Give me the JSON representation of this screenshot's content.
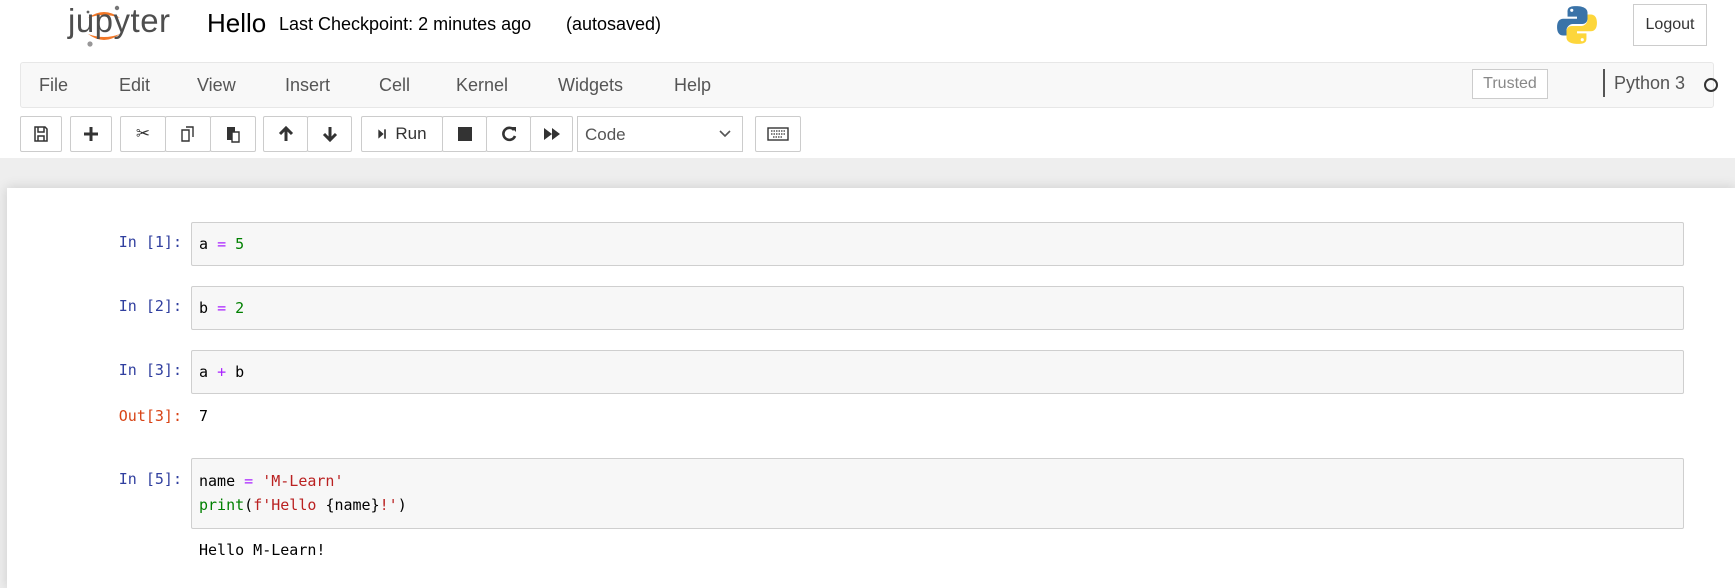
{
  "header": {
    "logo_text": "jupyter",
    "notebook_name": "Hello",
    "checkpoint": "Last Checkpoint: 2 minutes ago",
    "autosave": "(autosaved)",
    "logout": "Logout"
  },
  "menubar": {
    "items": [
      "File",
      "Edit",
      "View",
      "Insert",
      "Cell",
      "Kernel",
      "Widgets",
      "Help"
    ],
    "trusted": "Trusted",
    "kernel": "Python 3"
  },
  "toolbar": {
    "run": "Run",
    "cell_type": "Code"
  },
  "cells": [
    {
      "prompt": "In [1]:",
      "code": [
        {
          "t": "a ",
          "c": ""
        },
        {
          "t": "=",
          "c": "op"
        },
        {
          "t": " ",
          "c": ""
        },
        {
          "t": "5",
          "c": "num"
        }
      ]
    },
    {
      "prompt": "In [2]:",
      "code": [
        {
          "t": "b ",
          "c": ""
        },
        {
          "t": "=",
          "c": "op"
        },
        {
          "t": " ",
          "c": ""
        },
        {
          "t": "2",
          "c": "num"
        }
      ]
    },
    {
      "prompt": "In [3]:",
      "code": [
        {
          "t": "a ",
          "c": ""
        },
        {
          "t": "+",
          "c": "op"
        },
        {
          "t": " b",
          "c": ""
        }
      ],
      "out_prompt": "Out[3]:",
      "output": "7"
    },
    {
      "prompt": "In [5]:",
      "code": [
        {
          "t": "name ",
          "c": ""
        },
        {
          "t": "=",
          "c": "op"
        },
        {
          "t": " ",
          "c": ""
        },
        {
          "t": "'M-Learn'",
          "c": "str"
        },
        {
          "t": "\n",
          "c": ""
        },
        {
          "t": "print",
          "c": "kw"
        },
        {
          "t": "(",
          "c": ""
        },
        {
          "t": "f'Hello ",
          "c": "str"
        },
        {
          "t": "{name}",
          "c": ""
        },
        {
          "t": "!'",
          "c": "str"
        },
        {
          "t": ")",
          "c": ""
        }
      ],
      "output": "Hello M-Learn!"
    }
  ],
  "colors": {
    "in_prompt": "#303f9f",
    "out_prompt": "#d84315",
    "operator": "#aa22ff",
    "number": "#008000",
    "string": "#ba2121",
    "logo_orange": "#f37726"
  }
}
